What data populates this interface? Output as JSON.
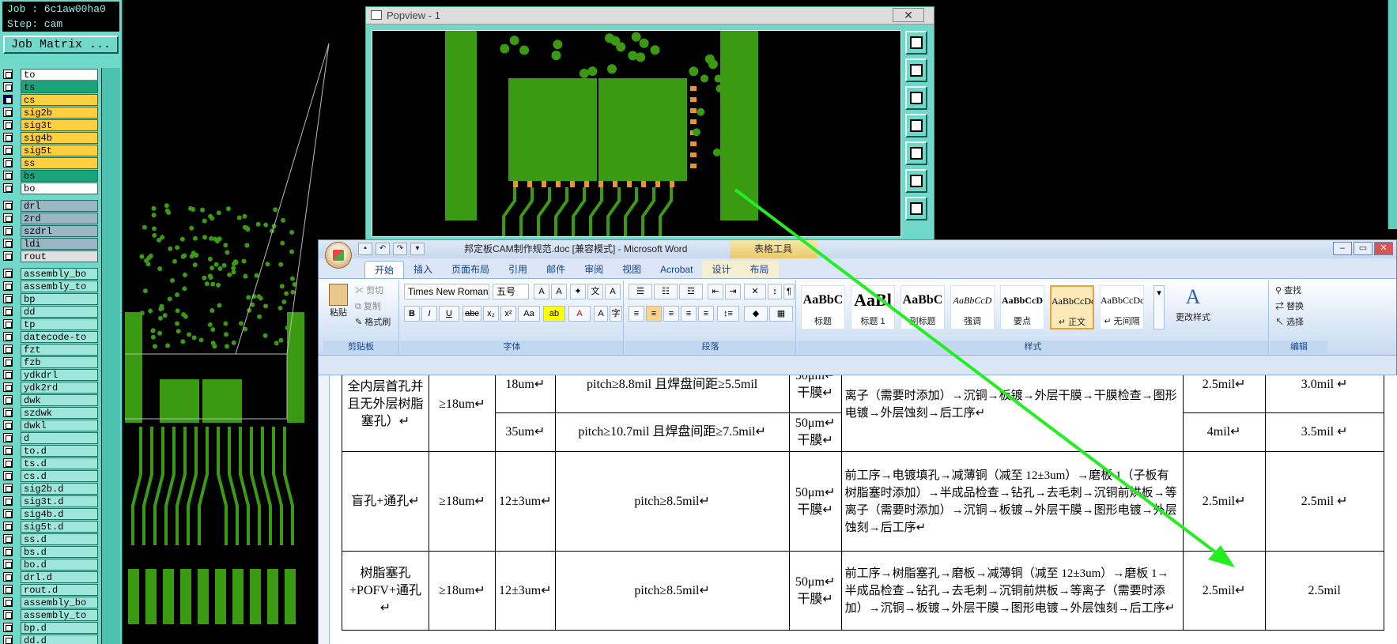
{
  "cam": {
    "job_line": "Job : 6c1aw00ha0",
    "step_line": "Step: cam",
    "matrix_button": "Job Matrix ...",
    "layers_group1": [
      {
        "name": "to",
        "color": "#ffffff",
        "checked": false
      },
      {
        "name": "ts",
        "color": "#1aa47a",
        "checked": false
      },
      {
        "name": "cs",
        "color": "#ffcf40",
        "checked": true
      },
      {
        "name": "sig2b",
        "color": "#ffcf40",
        "checked": false
      },
      {
        "name": "sig3t",
        "color": "#ffcf40",
        "checked": false
      },
      {
        "name": "sig4b",
        "color": "#ffcf40",
        "checked": false
      },
      {
        "name": "sig5t",
        "color": "#ffcf40",
        "checked": false
      },
      {
        "name": "ss",
        "color": "#ffcf40",
        "checked": false
      },
      {
        "name": "bs",
        "color": "#1aa47a",
        "checked": false
      },
      {
        "name": "bo",
        "color": "#ffffff",
        "checked": false
      }
    ],
    "layers_group2": [
      {
        "name": "drl",
        "color": "#9ab8c4",
        "checked": false
      },
      {
        "name": "2rd",
        "color": "#9ab8c4",
        "checked": false
      },
      {
        "name": "szdrl",
        "color": "#9ab8c4",
        "checked": false
      },
      {
        "name": "ldi",
        "color": "#9ab8c4",
        "checked": false
      },
      {
        "name": "rout",
        "color": "#e0e0e0",
        "checked": false
      }
    ],
    "layers_group3": [
      {
        "name": "assembly_bo",
        "color": "#9fe6da",
        "checked": false
      },
      {
        "name": "assembly_to",
        "color": "#9fe6da",
        "checked": false
      },
      {
        "name": "bp",
        "color": "#9fe6da",
        "checked": false
      },
      {
        "name": "dd",
        "color": "#9fe6da",
        "checked": false
      },
      {
        "name": "tp",
        "color": "#9fe6da",
        "checked": false
      },
      {
        "name": "datecode-to",
        "color": "#9fe6da",
        "checked": false
      },
      {
        "name": "fzt",
        "color": "#9fe6da",
        "checked": false
      },
      {
        "name": "fzb",
        "color": "#9fe6da",
        "checked": false
      },
      {
        "name": "ydkdrl",
        "color": "#9fe6da",
        "checked": false
      },
      {
        "name": "ydk2rd",
        "color": "#9fe6da",
        "checked": false
      },
      {
        "name": "dwk",
        "color": "#9fe6da",
        "checked": false
      },
      {
        "name": "szdwk",
        "color": "#9fe6da",
        "checked": false
      },
      {
        "name": "dwkl",
        "color": "#9fe6da",
        "checked": false
      },
      {
        "name": "d",
        "color": "#9fe6da",
        "checked": false
      },
      {
        "name": "to.d",
        "color": "#9fe6da",
        "checked": false
      },
      {
        "name": "ts.d",
        "color": "#9fe6da",
        "checked": false
      },
      {
        "name": "cs.d",
        "color": "#9fe6da",
        "checked": false
      },
      {
        "name": "sig2b.d",
        "color": "#9fe6da",
        "checked": false
      },
      {
        "name": "sig3t.d",
        "color": "#9fe6da",
        "checked": false
      },
      {
        "name": "sig4b.d",
        "color": "#9fe6da",
        "checked": false
      },
      {
        "name": "sig5t.d",
        "color": "#9fe6da",
        "checked": false
      },
      {
        "name": "ss.d",
        "color": "#9fe6da",
        "checked": false
      },
      {
        "name": "bs.d",
        "color": "#9fe6da",
        "checked": false
      },
      {
        "name": "bo.d",
        "color": "#9fe6da",
        "checked": false
      },
      {
        "name": "drl.d",
        "color": "#9fe6da",
        "checked": false
      },
      {
        "name": "rout.d",
        "color": "#9fe6da",
        "checked": false
      },
      {
        "name": "assembly_bo",
        "color": "#9fe6da",
        "checked": false
      },
      {
        "name": "assembly_to",
        "color": "#9fe6da",
        "checked": false
      },
      {
        "name": "bp.d",
        "color": "#9fe6da",
        "checked": false
      },
      {
        "name": "dd.d",
        "color": "#9fe6da",
        "checked": false
      }
    ],
    "copper_color": "#3a9a12",
    "pad_color": "#e8962a"
  },
  "popview": {
    "title": "Popview - 1",
    "close": "✕",
    "tools": [
      "zoom-fit-icon",
      "pan-up-icon",
      "pan-down-icon",
      "pan-left-icon",
      "pan-right-icon",
      "zoom-out-icon",
      "zoom-in-icon"
    ]
  },
  "word": {
    "title": "邦定板CAM制作规范.doc [兼容模式] - Microsoft Word",
    "context_tab_group": "表格工具",
    "window_controls": [
      "–",
      "▭",
      "✕"
    ],
    "tabs": [
      "开始",
      "插入",
      "页面布局",
      "引用",
      "邮件",
      "审阅",
      "视图",
      "Acrobat",
      "设计",
      "布局"
    ],
    "active_tab": "开始",
    "clipboard": {
      "paste": "粘贴",
      "cut": "剪切",
      "copy": "复制",
      "format_painter": "格式刷",
      "label": "剪贴板"
    },
    "font": {
      "name": "Times New Roman",
      "size": "五号",
      "label": "字体"
    },
    "paragraph_label": "段落",
    "styles": [
      {
        "preview": "AaBbC",
        "name": "标题"
      },
      {
        "preview": "AaBl",
        "name": "标题 1"
      },
      {
        "preview": "AaBbC",
        "name": "副标题"
      },
      {
        "preview": "AaBbCcD",
        "name": "强调"
      },
      {
        "preview": "AaBbCcD",
        "name": "要点"
      },
      {
        "preview": "AaBbCcDc",
        "name": "↵ 正文"
      },
      {
        "preview": "AaBbCcDc",
        "name": "↵ 无间隔"
      }
    ],
    "styles_label": "样式",
    "change_styles": "更改样式",
    "editing": {
      "find": "查找",
      "replace": "替换",
      "select": "选择",
      "label": "编辑"
    }
  },
  "table": {
    "rows": [
      {
        "c1": "全内层首孔并且无外层树脂塞孔）↵",
        "c2": "≥18um↵",
        "c3": "18um↵",
        "c4": "pitch≥8.8mil 且焊盘间距≥5.5mil",
        "c5": "50μm↵干膜↵",
        "c6": "离子（需要时添加）→沉铜→板镀→外层干膜→干膜检查→图形电镀→外层蚀刻→后工序↵",
        "c7": "2.5mil↵",
        "c8": "3.0mil ↵"
      },
      {
        "c3": "35um↵",
        "c4": "pitch≥10.7mil 且焊盘间距≥7.5mil↵",
        "c5": "50μm↵干膜↵",
        "c7": "4mil↵",
        "c8": "3.5mil ↵"
      },
      {
        "c1": "盲孔+通孔↵",
        "c2": "≥18um↵",
        "c3": "12±3um↵",
        "c4": "pitch≥8.5mil↵",
        "c5": "50μm↵干膜↵",
        "c6": "前工序→电镀填孔→减薄铜（减至 12±3um）→磨板 1（子板有树脂塞时添加）→半成品检查→钻孔→去毛刺→沉铜前烘板→等离子（需要时添加）→沉铜→板镀→外层干膜→图形电镀→外层蚀刻→后工序↵",
        "c7": "2.5mil↵",
        "c8": "2.5mil ↵"
      },
      {
        "c1": "树脂塞孔+POFV+通孔↵",
        "c2": "≥18um↵",
        "c3": "12±3um↵",
        "c4": "pitch≥8.5mil↵",
        "c5": "50μm↵干膜↵",
        "c6": "前工序→树脂塞孔→磨板→减薄铜（减至 12±3um）→磨板 1→半成品检查→钻孔→去毛刺→沉铜前烘板→等离子（需要时添加）→沉铜→板镀→外层干膜→图形电镀→外层蚀刻→后工序↵",
        "c7": "2.5mil↵",
        "c8": "2.5mil"
      }
    ]
  },
  "arrow_color": "#22ee22"
}
